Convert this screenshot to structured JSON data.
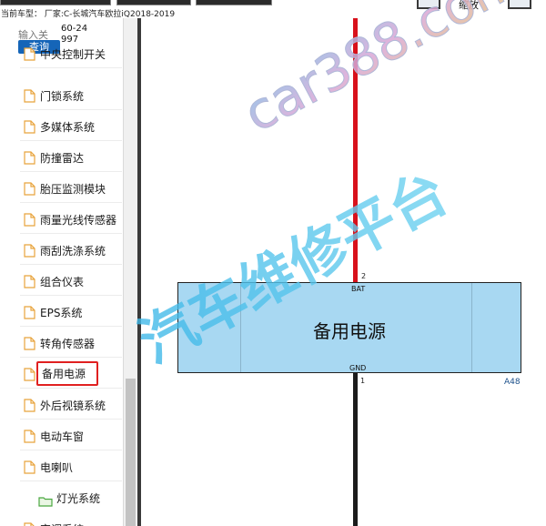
{
  "header": {
    "car_info": "当前车型：  厂家:C-长城汽车欧拉iQ2018-2019",
    "zoom_label": "缩放"
  },
  "sidebar": {
    "search_placeholder": "输入关",
    "search_value": "60-24997",
    "search_button": "查询",
    "items": [
      {
        "label": "中央控制开关"
      },
      {
        "label": "门锁系统"
      },
      {
        "label": "多媒体系统"
      },
      {
        "label": "防撞雷达"
      },
      {
        "label": "胎压监测模块"
      },
      {
        "label": "雨量光线传感器"
      },
      {
        "label": "雨刮洗涤系统"
      },
      {
        "label": "组合仪表"
      },
      {
        "label": "EPS系统"
      },
      {
        "label": "转角传感器"
      },
      {
        "label": "备用电源"
      },
      {
        "label": "外后视镜系统"
      },
      {
        "label": "电动车窗"
      },
      {
        "label": "电喇叭"
      }
    ],
    "folder": {
      "label": "灯光系统"
    },
    "last_item": {
      "label": "空调系统"
    },
    "selected_index": 10
  },
  "diagram": {
    "component_name": "备用电源",
    "component_code": "A48",
    "pin_top_label": "BAT",
    "pin_top_number": "2",
    "pin_bottom_label": "GND",
    "pin_bottom_number": "1",
    "wire_bat_color": "#d8111b",
    "wire_gnd_color": "#1b1b1b",
    "component_fill": "#a8d8f2"
  },
  "watermark": {
    "line1": "car388.com",
    "line2": "汽车维修平台"
  },
  "colors": {
    "accent": "#1565b8",
    "selection_border": "#e02020"
  }
}
